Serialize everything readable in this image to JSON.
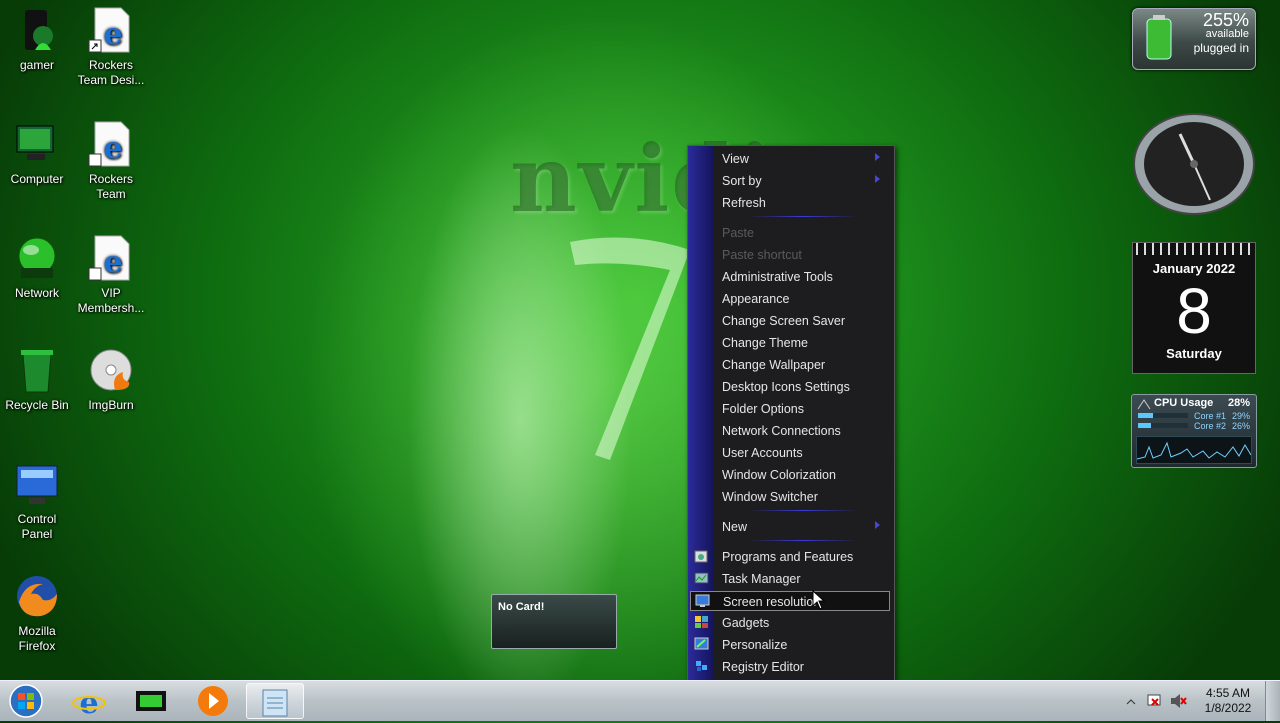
{
  "desktop": {
    "icons": [
      {
        "label": "gamer",
        "icon": "gamer-icon"
      },
      {
        "label": "Rockers\nTeam Desi...",
        "icon": "ie-shortcut-icon"
      },
      {
        "label": "Computer",
        "icon": "computer-icon"
      },
      {
        "label": "Rockers\nTeam",
        "icon": "ie-shortcut-icon"
      },
      {
        "label": "Network",
        "icon": "network-icon"
      },
      {
        "label": "VIP\nMembersh...",
        "icon": "ie-shortcut-icon"
      },
      {
        "label": "Recycle Bin",
        "icon": "recycle-bin-icon"
      },
      {
        "label": "ImgBurn",
        "icon": "imgburn-icon"
      },
      {
        "label": "Control\nPanel",
        "icon": "control-panel-icon"
      },
      {
        "label": "Mozilla\nFirefox",
        "icon": "firefox-icon"
      }
    ],
    "wallpaper_text": "nvidia",
    "colors": {
      "accent_green": "#2fb52a",
      "menu_gutter": "#2b2b9a"
    }
  },
  "gadgets": {
    "battery": {
      "percent": "255%",
      "line1": "available",
      "line2": "plugged in"
    },
    "calendar": {
      "month": "January 2022",
      "day": "8",
      "weekday": "Saturday"
    },
    "cpu": {
      "title": "CPU Usage",
      "total": "28%",
      "core1_label": "Core #1",
      "core1_value": "29%",
      "core1_level": 0.29,
      "core2_label": "Core #2",
      "core2_value": "26%",
      "core2_level": 0.26
    }
  },
  "context_menu": {
    "items": [
      {
        "label": "View",
        "submenu": true
      },
      {
        "label": "Sort by",
        "submenu": true
      },
      {
        "label": "Refresh"
      },
      {
        "label": "Paste",
        "disabled": true
      },
      {
        "label": "Paste shortcut",
        "disabled": true
      },
      {
        "label": "Administrative Tools"
      },
      {
        "label": "Appearance"
      },
      {
        "label": "Change Screen Saver"
      },
      {
        "label": "Change Theme"
      },
      {
        "label": "Change Wallpaper"
      },
      {
        "label": "Desktop Icons Settings"
      },
      {
        "label": "Folder Options"
      },
      {
        "label": "Network Connections"
      },
      {
        "label": "User Accounts"
      },
      {
        "label": "Window Colorization"
      },
      {
        "label": "Window Switcher"
      },
      {
        "label": "New",
        "submenu": true
      },
      {
        "label": "Programs and Features",
        "icon": "programs-icon"
      },
      {
        "label": "Task Manager",
        "icon": "task-manager-icon"
      },
      {
        "label": "Screen resolution",
        "icon": "screen-resolution-icon",
        "highlighted": true
      },
      {
        "label": "Gadgets",
        "icon": "gadgets-icon"
      },
      {
        "label": "Personalize",
        "icon": "personalize-icon"
      },
      {
        "label": "Registry Editor",
        "icon": "registry-editor-icon"
      }
    ]
  },
  "popup": {
    "text": "No Card!"
  },
  "taskbar": {
    "buttons": [
      "start-orb-icon",
      "ie-icon",
      "video-card-icon",
      "media-player-icon",
      "notepad-icon"
    ],
    "clock": {
      "time": "4:55 AM",
      "date": "1/8/2022"
    }
  }
}
